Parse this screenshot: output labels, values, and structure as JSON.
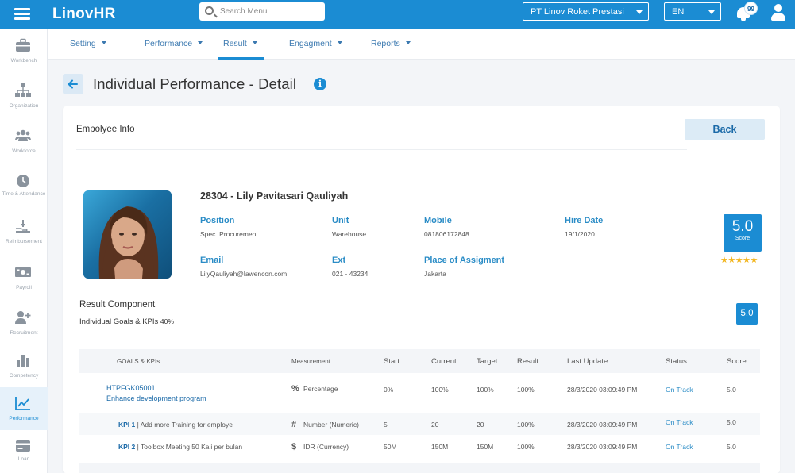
{
  "app": {
    "brand": "LinovHR",
    "search_placeholder": "Search Menu",
    "company": "PT Linov Roket Prestasi",
    "language": "EN",
    "notification_count": "99"
  },
  "sidebar": {
    "items": [
      {
        "label": "Workbench",
        "icon": "briefcase-icon"
      },
      {
        "label": "Organization",
        "icon": "org-chart-icon"
      },
      {
        "label": "Workforce",
        "icon": "people-icon"
      },
      {
        "label": "Time & Attendance",
        "icon": "clock-icon"
      },
      {
        "label": "Reimbursement",
        "icon": "hand-money-icon"
      },
      {
        "label": "Payroll",
        "icon": "money-icon"
      },
      {
        "label": "Recruitment",
        "icon": "add-user-icon"
      },
      {
        "label": "Competency",
        "icon": "bar-chart-icon"
      },
      {
        "label": "Performance",
        "icon": "line-chart-icon"
      },
      {
        "label": "Loan",
        "icon": "card-icon"
      }
    ],
    "active_index": 8
  },
  "subnav": {
    "items": [
      "Setting",
      "Performance",
      "Result",
      "Engagment",
      "Reports"
    ],
    "active": "Result"
  },
  "page": {
    "title": "Individual Performance - Detail"
  },
  "card": {
    "title": "Empolyee Info",
    "back_label": "Back"
  },
  "employee": {
    "name": "28304 - Lily Pavitasari Qauliyah",
    "position_label": "Position",
    "position": "Spec. Procurement",
    "unit_label": "Unit",
    "unit": "Warehouse",
    "mobile_label": "Mobile",
    "mobile": "081806172848",
    "hire_label": "Hire Date",
    "hire_date": "19/1/2020",
    "email_label": "Email",
    "email": "LilyQauliyah@lawencon.com",
    "ext_label": "Ext",
    "ext": "021 - 43234",
    "place_label": "Place of Assigment",
    "place": "Jakarta",
    "score": "5.0",
    "score_label": "Score",
    "stars": "★★★★★",
    "rating": 5
  },
  "result_component": {
    "title": "Result Component",
    "subtitle": "Individual Goals & KPIs",
    "percent": "40%",
    "score": "5.0"
  },
  "table": {
    "headers": {
      "goals": "GOALS & KPIs",
      "measurement": "Measurement",
      "start": "Start",
      "current": "Current",
      "target": "Target",
      "result": "Result",
      "last_update": "Last Update",
      "status": "Status",
      "score": "Score"
    },
    "goal": {
      "code": "HTPFGK05001",
      "name": "Enhance development program",
      "measurement_icon": "%",
      "measurement": "Percentage",
      "start": "0%",
      "current": "100%",
      "target": "100%",
      "result": "100%",
      "last_update": "28/3/2020 03:09:49 PM",
      "status": "On Track",
      "score": "5.0"
    },
    "kpis": [
      {
        "code": "KPI 1",
        "name": "Add more Training for employe",
        "measurement_icon": "#",
        "measurement": "Number (Numeric)",
        "start": "5",
        "current": "20",
        "target": "20",
        "result": "100%",
        "last_update": "28/3/2020 03:09:49 PM",
        "status": "On Track",
        "score": "5.0"
      },
      {
        "code": "KPI 2",
        "name": "Toolbox Meeting 50 Kali per bulan",
        "measurement_icon": "$",
        "measurement": "IDR (Currency)",
        "start": "50M",
        "current": "150M",
        "target": "150M",
        "result": "100%",
        "last_update": "28/3/2020 03:09:49 PM",
        "status": "On Track",
        "score": "5.0"
      }
    ]
  },
  "colors": {
    "primary": "#1b8cd3",
    "accent_text": "#2a8cc6",
    "star": "#f2b51d"
  }
}
